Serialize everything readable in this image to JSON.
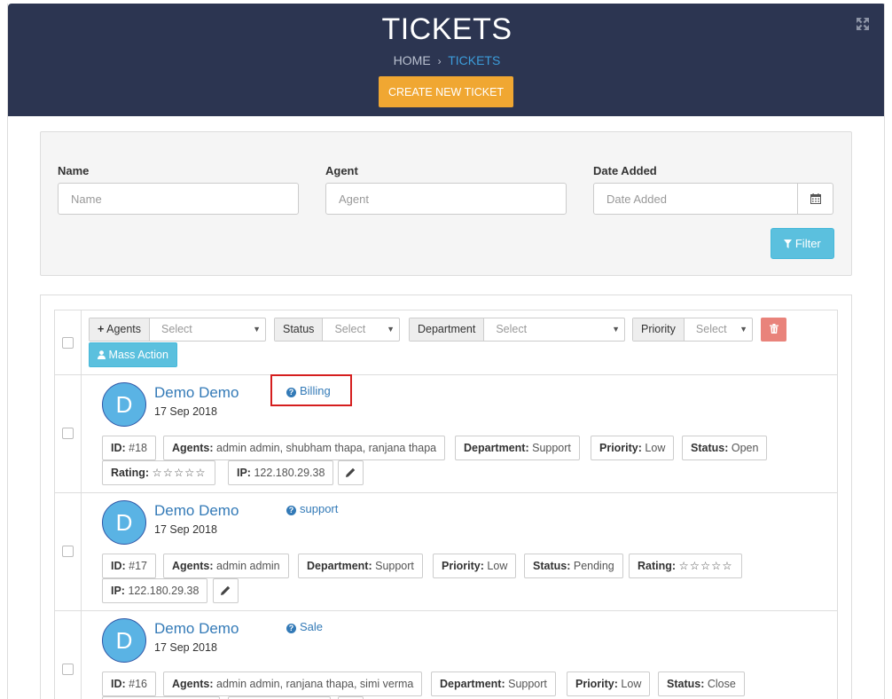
{
  "header": {
    "title": "TICKETS",
    "breadcrumb": {
      "home": "HOME",
      "separator": "›",
      "current": "TICKETS"
    },
    "create_button": "CREATE NEW TICKET"
  },
  "filters": {
    "name": {
      "label": "Name",
      "placeholder": "Name"
    },
    "agent": {
      "label": "Agent",
      "placeholder": "Agent"
    },
    "date_added": {
      "label": "Date Added",
      "placeholder": "Date Added"
    },
    "filter_button": "Filter"
  },
  "mass_actions": {
    "agents": {
      "label": "Agents",
      "value": "Select"
    },
    "status": {
      "label": "Status",
      "value": "Select"
    },
    "department": {
      "label": "Department",
      "value": "Select"
    },
    "priority": {
      "label": "Priority",
      "value": "Select"
    },
    "mass_action_button": "Mass Action"
  },
  "tickets": [
    {
      "initial": "D",
      "name": "Demo Demo",
      "date": "17 Sep 2018",
      "category": "Billing",
      "id_label": "ID:",
      "id": "#18",
      "agents_label": "Agents:",
      "agents": "admin admin, shubham thapa, ranjana thapa",
      "department_label": "Department:",
      "department": "Support",
      "priority_label": "Priority:",
      "priority": "Low",
      "status_label": "Status:",
      "status": "Open",
      "rating_label": "Rating:",
      "rating": "☆☆☆☆☆",
      "ip_label": "IP:",
      "ip": "122.180.29.38"
    },
    {
      "initial": "D",
      "name": "Demo Demo",
      "date": "17 Sep 2018",
      "category": "support",
      "id_label": "ID:",
      "id": "#17",
      "agents_label": "Agents:",
      "agents": "admin admin",
      "department_label": "Department:",
      "department": "Support",
      "priority_label": "Priority:",
      "priority": "Low",
      "status_label": "Status:",
      "status": "Pending",
      "rating_label": "Rating:",
      "rating": "☆☆☆☆☆",
      "ip_label": "IP:",
      "ip": "122.180.29.38"
    },
    {
      "initial": "D",
      "name": "Demo Demo",
      "date": "17 Sep 2018",
      "category": "Sale",
      "id_label": "ID:",
      "id": "#16",
      "agents_label": "Agents:",
      "agents": "admin admin, ranjana thapa, simi verma",
      "department_label": "Department:",
      "department": "Support",
      "priority_label": "Priority:",
      "priority": "Low",
      "status_label": "Status:",
      "status": "Close"
    }
  ],
  "colors": {
    "header_bg": "#2c3551",
    "accent_orange": "#f0a732",
    "info_blue": "#5bc0de",
    "link_blue": "#337ab7",
    "danger": "#e9837b",
    "highlight_box": "#d51e1e"
  }
}
